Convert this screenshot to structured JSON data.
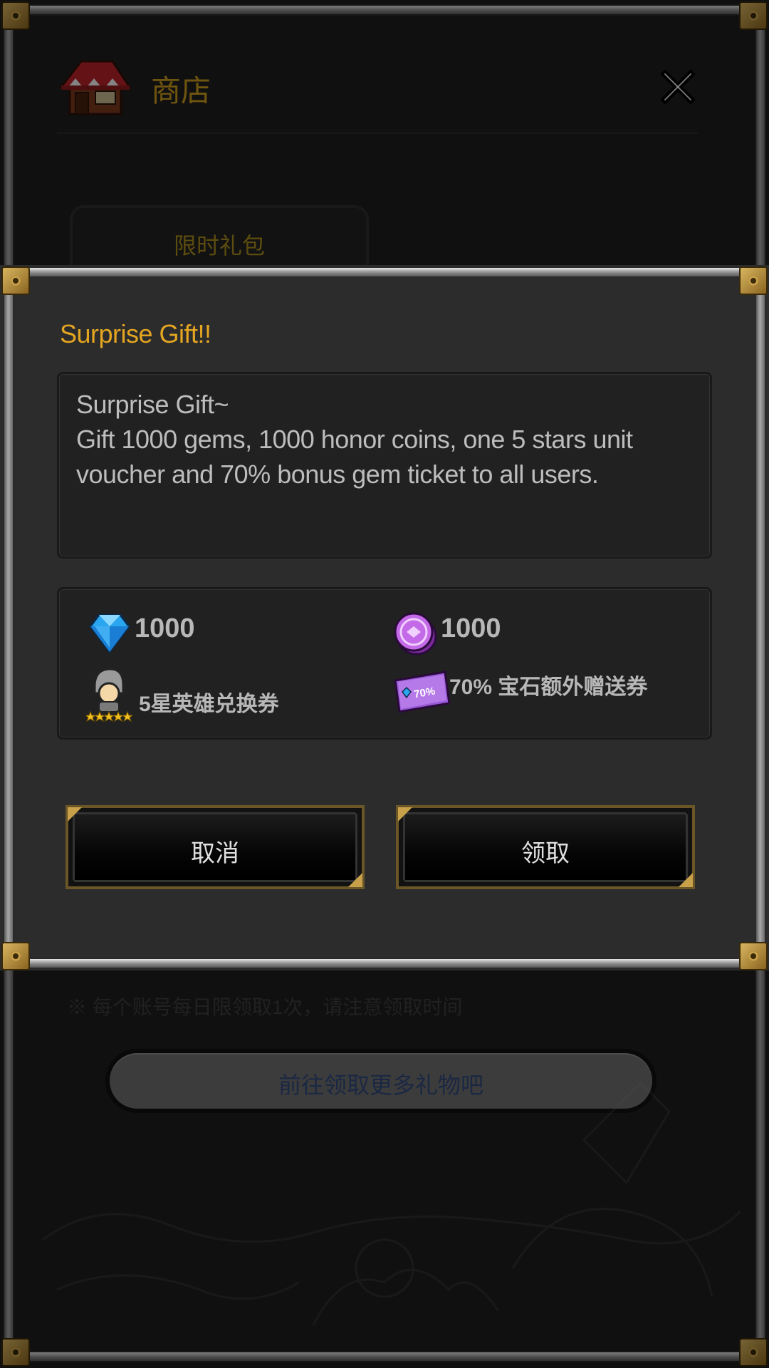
{
  "background": {
    "header_title": "商店",
    "tab_label": "限时礼包",
    "notice_text": "※ 每个账号每日限领取1次，请注意领取时间",
    "bottom_button_label": "前往领取更多礼物吧"
  },
  "dialog": {
    "title": "Surprise Gift!!",
    "message": "Surprise Gift~\nGift 1000 gems, 1000 honor coins, one 5 stars unit voucher and 70% bonus gem ticket to all users.",
    "rewards": [
      {
        "icon": "gem-icon",
        "amount": "1000"
      },
      {
        "icon": "honor-coin-icon",
        "amount": "1000"
      },
      {
        "icon": "unit-voucher-icon",
        "amount": "5星英雄兑换券"
      },
      {
        "icon": "bonus-ticket-icon",
        "amount": "70% 宝石额外赠送券"
      }
    ],
    "buttons": {
      "left_label": "取消",
      "right_label": "领取"
    }
  },
  "colors": {
    "title_gold": "#e4a521",
    "header_gold": "#c99a1c",
    "panel": "#2c2c2c",
    "box": "#212121",
    "text_light": "#bdbdbd"
  }
}
